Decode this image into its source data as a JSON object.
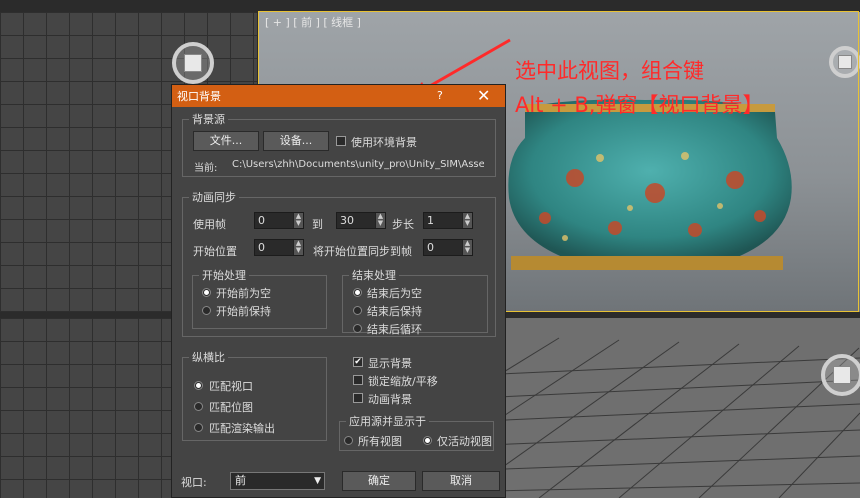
{
  "viewport": {
    "label": "[ + ] [ 前 ] [ 线框 ]"
  },
  "annotation": {
    "line1": "选中此视图，组合键",
    "line2": "Alt + B,弹窗【视口背景】"
  },
  "dialog": {
    "title": "视口背景",
    "help": "?",
    "close": "✕",
    "bg_source": {
      "legend": "背景源",
      "files_btn": "文件...",
      "devices_btn": "设备...",
      "use_env_label": "使用环境背景",
      "use_env_checked": false,
      "current_label": "当前:",
      "current_path": "C:\\Users\\zhh\\Documents\\unity_pro\\Unity_SIM\\Assets\\im"
    },
    "anim_sync": {
      "legend": "动画同步",
      "use_frame_label": "使用帧",
      "use_frame_value": "0",
      "to_label": "到",
      "to_value": "30",
      "step_label": "步长",
      "step_value": "1",
      "start_pos_label": "开始位置",
      "start_pos_value": "0",
      "sync_label": "将开始位置同步到帧",
      "sync_value": "0",
      "start_proc": {
        "legend": "开始处理",
        "options": [
          "开始前为空",
          "开始前保持"
        ],
        "selected": 0
      },
      "end_proc": {
        "legend": "结束处理",
        "options": [
          "结束后为空",
          "结束后保持",
          "结束后循环"
        ],
        "selected": 0
      }
    },
    "aspect": {
      "legend": "纵横比",
      "options": [
        "匹配视口",
        "匹配位图",
        "匹配渲染输出"
      ],
      "selected": 0
    },
    "checks": [
      {
        "label": "显示背景",
        "checked": true
      },
      {
        "label": "锁定缩放/平移",
        "checked": false
      },
      {
        "label": "动画背景",
        "checked": false
      }
    ],
    "apply": {
      "legend": "应用源并显示于",
      "options": [
        "所有视图",
        "仅活动视图"
      ],
      "selected": 1
    },
    "viewport_label": "视口:",
    "viewport_value": "前",
    "ok": "确定",
    "cancel": "取消"
  },
  "colors": {
    "title_bar": "#d35f13",
    "annotation": "#ff2a2a",
    "active_border": "#e8c234"
  }
}
